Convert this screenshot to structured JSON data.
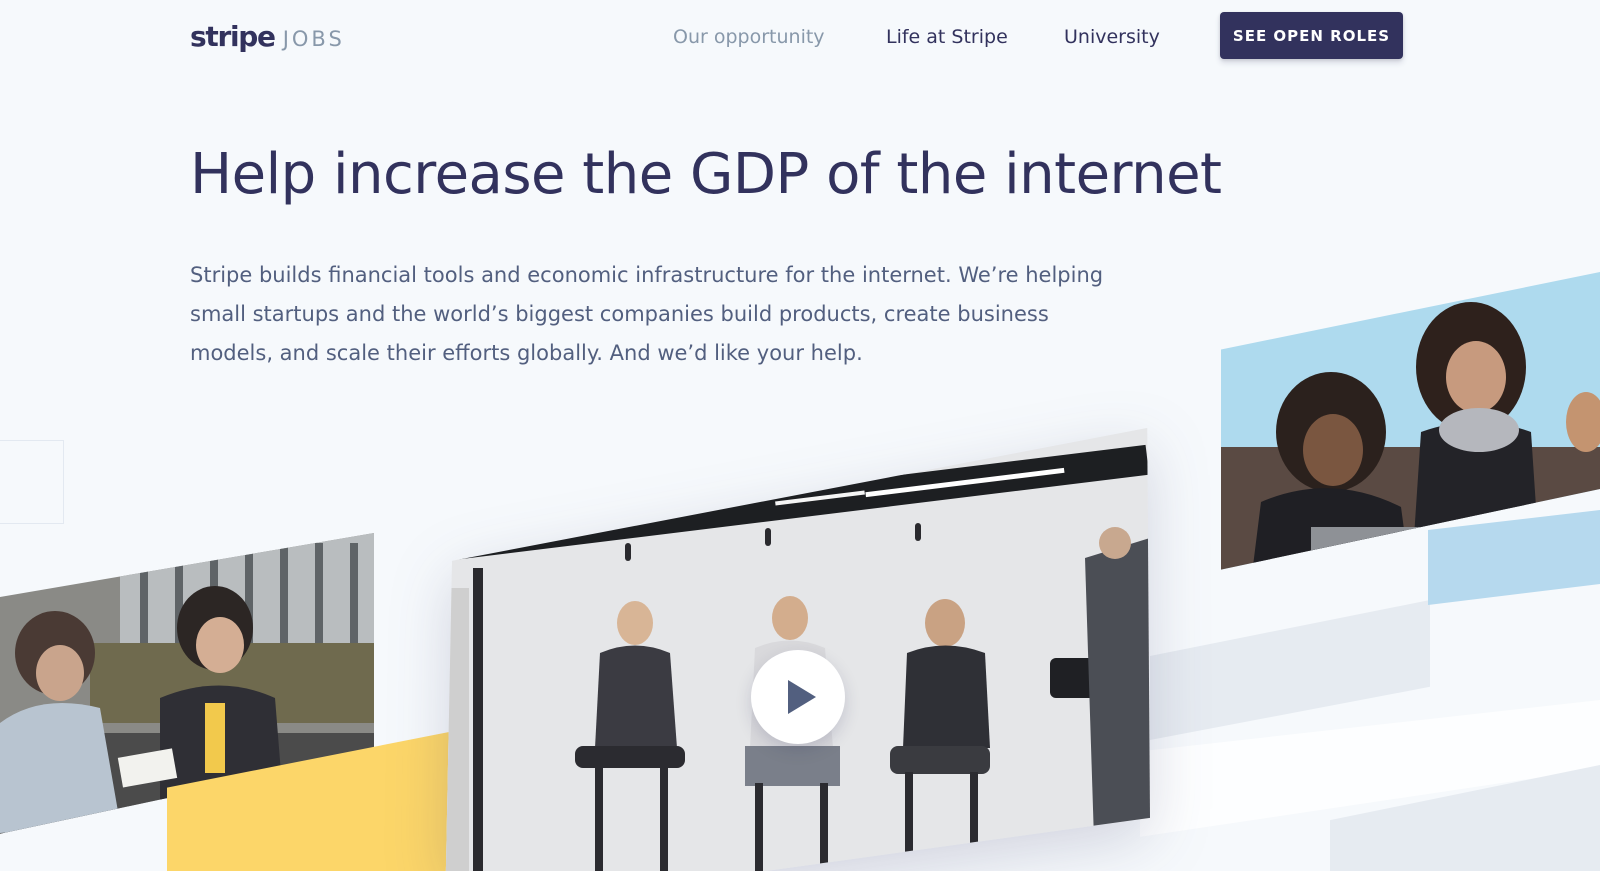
{
  "header": {
    "logo_word": "stripe",
    "logo_suffix": "JOBS",
    "nav": [
      {
        "label": "Our opportunity",
        "active": true
      },
      {
        "label": "Life at Stripe",
        "active": false
      },
      {
        "label": "University",
        "active": false
      }
    ],
    "cta_label": "SEE OPEN ROLES"
  },
  "hero": {
    "headline": "Help increase the GDP of the internet",
    "lede": "Stripe builds financial tools and economic infrastructure for the internet. We’re helping small startups and the world’s biggest companies build products, create business models, and scale their efforts globally. And we’d like your help."
  },
  "media": {
    "video_play_icon": "play-icon"
  },
  "colors": {
    "brand_navy": "#32325d",
    "text_muted": "#8898aa",
    "body_text": "#525f7f",
    "background": "#f6f9fc",
    "accent_yellow": "#fcd669",
    "accent_blue": "#b6d9ee"
  }
}
